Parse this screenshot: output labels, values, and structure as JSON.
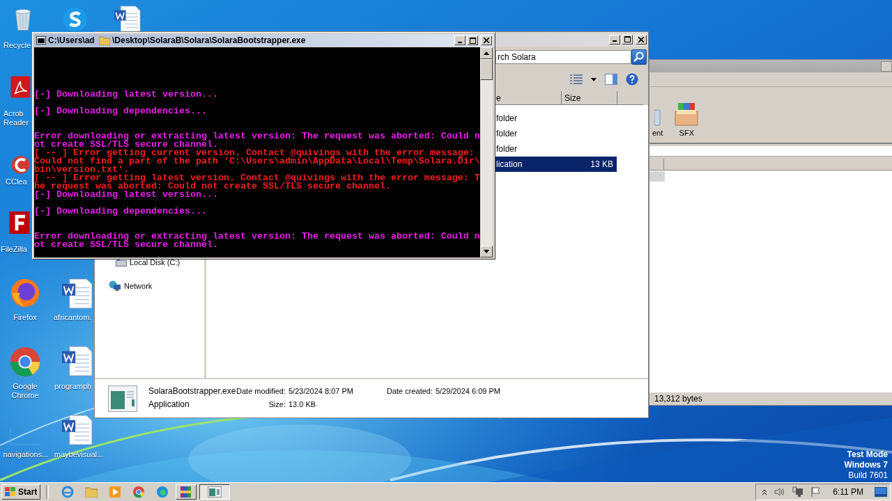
{
  "desktop": {
    "icons": [
      {
        "kind": "recycle",
        "label": "Recycle"
      },
      {
        "kind": "skype"
      },
      {
        "kind": "word"
      },
      {
        "kind": "acrobat",
        "label": "Acrob Reader"
      },
      {
        "kind": "ccleaner",
        "label": "CClea"
      },
      {
        "kind": "filezilla",
        "label": "FileZilla"
      },
      {
        "kind": "firefox",
        "label": "Firefox"
      },
      {
        "kind": "word",
        "label": "africantom."
      },
      {
        "kind": "chrome",
        "label": "Google Chrome"
      },
      {
        "kind": "word",
        "label": "programph"
      },
      {
        "kind": "blank",
        "label": "navigations..."
      },
      {
        "kind": "word",
        "label": "maybevisual..."
      }
    ],
    "test_mode": [
      "Test Mode",
      "Windows 7",
      "Build 7601"
    ]
  },
  "winrar": {
    "toolbar": [
      {
        "kind": "partial",
        "label": "ent"
      },
      {
        "kind": "sfx",
        "label": "SFX"
      }
    ],
    "status": "13,312 bytes"
  },
  "explorer": {
    "search": {
      "value": "rch Solara"
    },
    "columns": [
      "e",
      "Size"
    ],
    "rows": [
      {
        "type": "folder",
        "selected": false
      },
      {
        "type": "folder",
        "selected": false
      },
      {
        "type": "folder",
        "selected": false
      },
      {
        "type": "lication",
        "size": "13 KB",
        "selected": true
      }
    ],
    "sidebar": [
      {
        "kind": "drive",
        "label": "Local Disk (C:)"
      },
      {
        "kind": "network",
        "label": "Network"
      }
    ],
    "details": {
      "name": "SolaraBootstrapper.exe",
      "type": "Application",
      "fields": [
        {
          "label": "Date modified:",
          "value": "5/23/2024 8:07 PM"
        },
        {
          "label": "Size:",
          "value": "13.0 KB"
        },
        {
          "label": "Date created:",
          "value": "5/29/2024 6:09 PM"
        }
      ]
    }
  },
  "console": {
    "title_parts": [
      "C:\\Users\\ad",
      "\\Desktop\\SolaraB\\Solara\\SolaraBootstrapper.exe"
    ],
    "lines": [
      {
        "kind": "info",
        "text": "[-] Downloading latest version..."
      },
      {
        "kind": "blank"
      },
      {
        "kind": "info",
        "text": "[-] Downloading dependencies..."
      },
      {
        "kind": "blank"
      },
      {
        "kind": "blank"
      },
      {
        "kind": "info",
        "text": "Error downloading or extracting latest version: The request was aborted: Could n"
      },
      {
        "kind": "info",
        "text": "ot create SSL/TLS secure channel."
      },
      {
        "kind": "error",
        "text": "[ -- ] Error getting current version. Contact @quivings with the error message:"
      },
      {
        "kind": "error",
        "text": "Could not find a part of the path 'C:\\Users\\admin\\AppData\\Local\\Temp\\Solara.Dir\\"
      },
      {
        "kind": "error",
        "text": "bin\\version.txt'."
      },
      {
        "kind": "error",
        "text": "[ -- ] Error getting latest version. Contact @quivings with the error message: T"
      },
      {
        "kind": "error",
        "text": "he request was aborted: Could not create SSL/TLS secure channel."
      },
      {
        "kind": "info",
        "text": "[-] Downloading latest version..."
      },
      {
        "kind": "blank"
      },
      {
        "kind": "info",
        "text": "[-] Downloading dependencies..."
      },
      {
        "kind": "blank"
      },
      {
        "kind": "blank"
      },
      {
        "kind": "info",
        "text": "Error downloading or extracting latest version: The request was aborted: Could n"
      },
      {
        "kind": "info",
        "text": "ot create SSL/TLS secure channel."
      }
    ]
  },
  "taskbar": {
    "start": "Start",
    "apps": [
      {
        "kind": "ie",
        "open": false,
        "selected": false
      },
      {
        "kind": "folder",
        "open": false,
        "selected": false
      },
      {
        "kind": "media",
        "open": false,
        "selected": false
      },
      {
        "kind": "chrome",
        "open": false,
        "selected": false
      },
      {
        "kind": "edge",
        "open": false,
        "selected": false
      },
      {
        "kind": "winrar",
        "open": true,
        "selected": false
      },
      {
        "kind": "console",
        "open": true,
        "selected": true
      }
    ],
    "clock": "6:11 PM"
  }
}
